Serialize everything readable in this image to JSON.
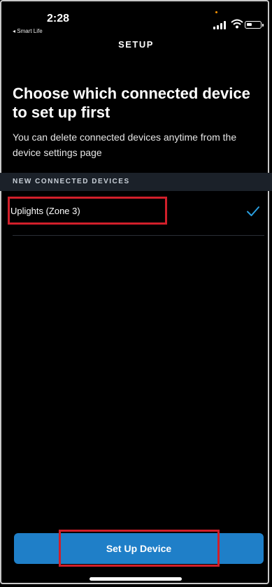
{
  "status_bar": {
    "time": "2:28",
    "back_app": "◂ Smart Life",
    "icons": [
      "signal-icon",
      "wifi-icon",
      "battery-icon"
    ]
  },
  "header": {
    "title": "SETUP"
  },
  "main": {
    "heading": "Choose which connected device to set up first",
    "subtext": "You can delete connected devices anytime from the device settings page",
    "section_header": "NEW CONNECTED DEVICES",
    "devices": [
      {
        "label": "Uplights (Zone 3)",
        "selected": true,
        "check_icon": "check-icon"
      }
    ]
  },
  "footer": {
    "button_label": "Set Up Device"
  },
  "colors": {
    "background": "#000000",
    "accent": "#1f7fc8",
    "highlight": "#d11f2a",
    "section_bg": "#1b2129",
    "check": "#2a9fe0"
  }
}
